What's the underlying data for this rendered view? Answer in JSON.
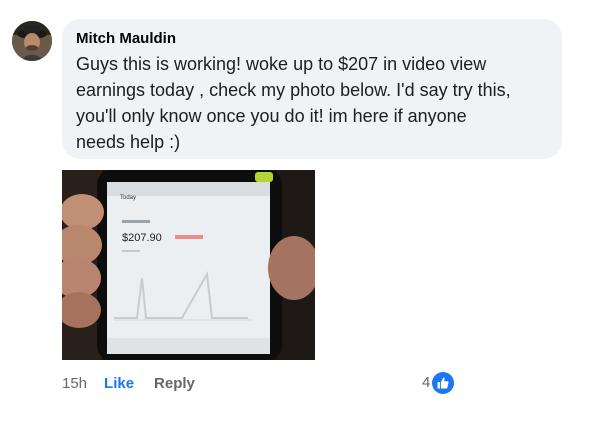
{
  "comment": {
    "author": "Mitch Mauldin",
    "text": "Guys this is working! woke up to $207 in video view\nearnings today , check my photo below. I'd say try this,\nyou'll only know once you do it! im here if anyone\nneeds help :)"
  },
  "photo": {
    "screen_header": "Today",
    "amount": "$207.90"
  },
  "actions": {
    "time": "15h",
    "like_label": "Like",
    "reply_label": "Reply"
  },
  "reactions": {
    "count": "4",
    "icon": "thumbs-up-icon",
    "color": "#1877f2"
  }
}
